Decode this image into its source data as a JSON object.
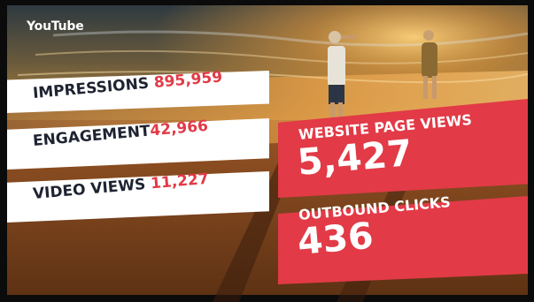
{
  "platform": "YouTube",
  "stats": [
    {
      "label": "IMPRESSIONS",
      "value": "895,959"
    },
    {
      "label": "ENGAGEMENT",
      "value": "42,966"
    },
    {
      "label": "VIDEO VIEWS",
      "value": "11,227"
    }
  ],
  "highlights": [
    {
      "label": "WEBSITE PAGE VIEWS",
      "value": "5,427"
    },
    {
      "label": "OUTBOUND CLICKS",
      "value": "436"
    }
  ],
  "colors": {
    "accent_red": "#e23a47",
    "dark_text": "#1f2331",
    "band_white": "#ffffff"
  }
}
